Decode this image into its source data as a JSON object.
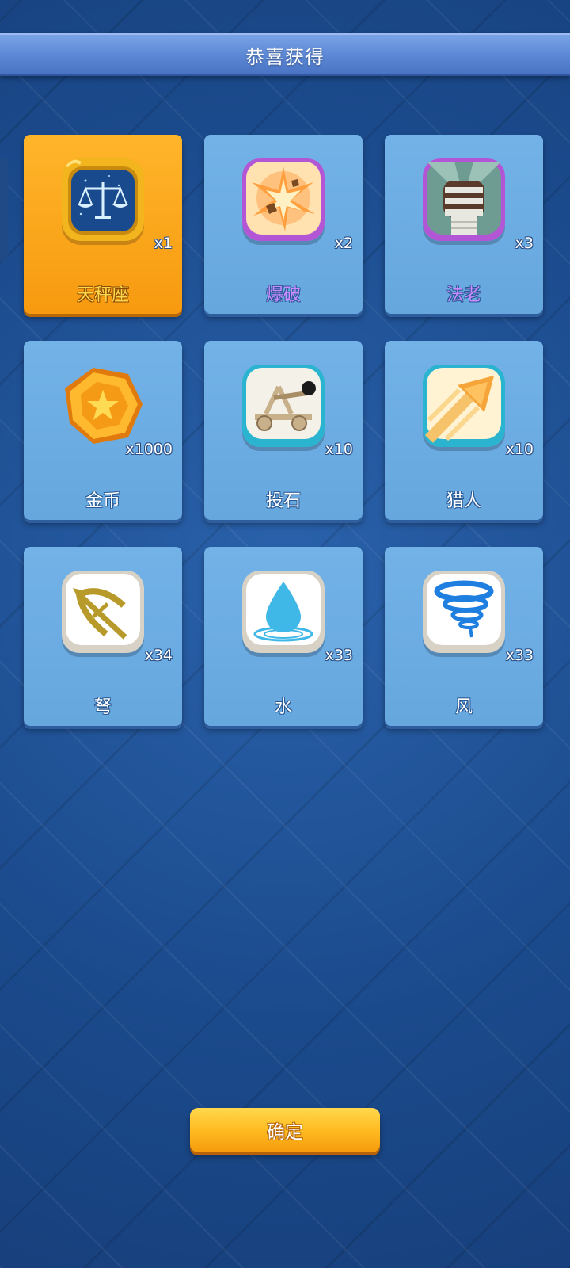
{
  "header": {
    "title": "恭喜获得"
  },
  "rewards": [
    {
      "name": "天秤座",
      "qty": "x1",
      "icon": "libra-zodiac-icon"
    },
    {
      "name": "爆破",
      "qty": "x2",
      "icon": "explosion-icon"
    },
    {
      "name": "法老",
      "qty": "x3",
      "icon": "pharaoh-fist-icon"
    },
    {
      "name": "金币",
      "qty": "x1000",
      "icon": "gold-coin-icon"
    },
    {
      "name": "投石",
      "qty": "x10",
      "icon": "catapult-icon"
    },
    {
      "name": "猎人",
      "qty": "x10",
      "icon": "hunter-arrow-icon"
    },
    {
      "name": "弩",
      "qty": "x34",
      "icon": "crossbow-icon"
    },
    {
      "name": "水",
      "qty": "x33",
      "icon": "water-drop-icon"
    },
    {
      "name": "风",
      "qty": "x33",
      "icon": "tornado-icon"
    }
  ],
  "footer": {
    "confirm_label": "确定"
  },
  "colors": {
    "background": "#1d4f93",
    "card": "#6aaae0",
    "highlight_card": "#f8a31a",
    "button": "#ffbc21"
  }
}
